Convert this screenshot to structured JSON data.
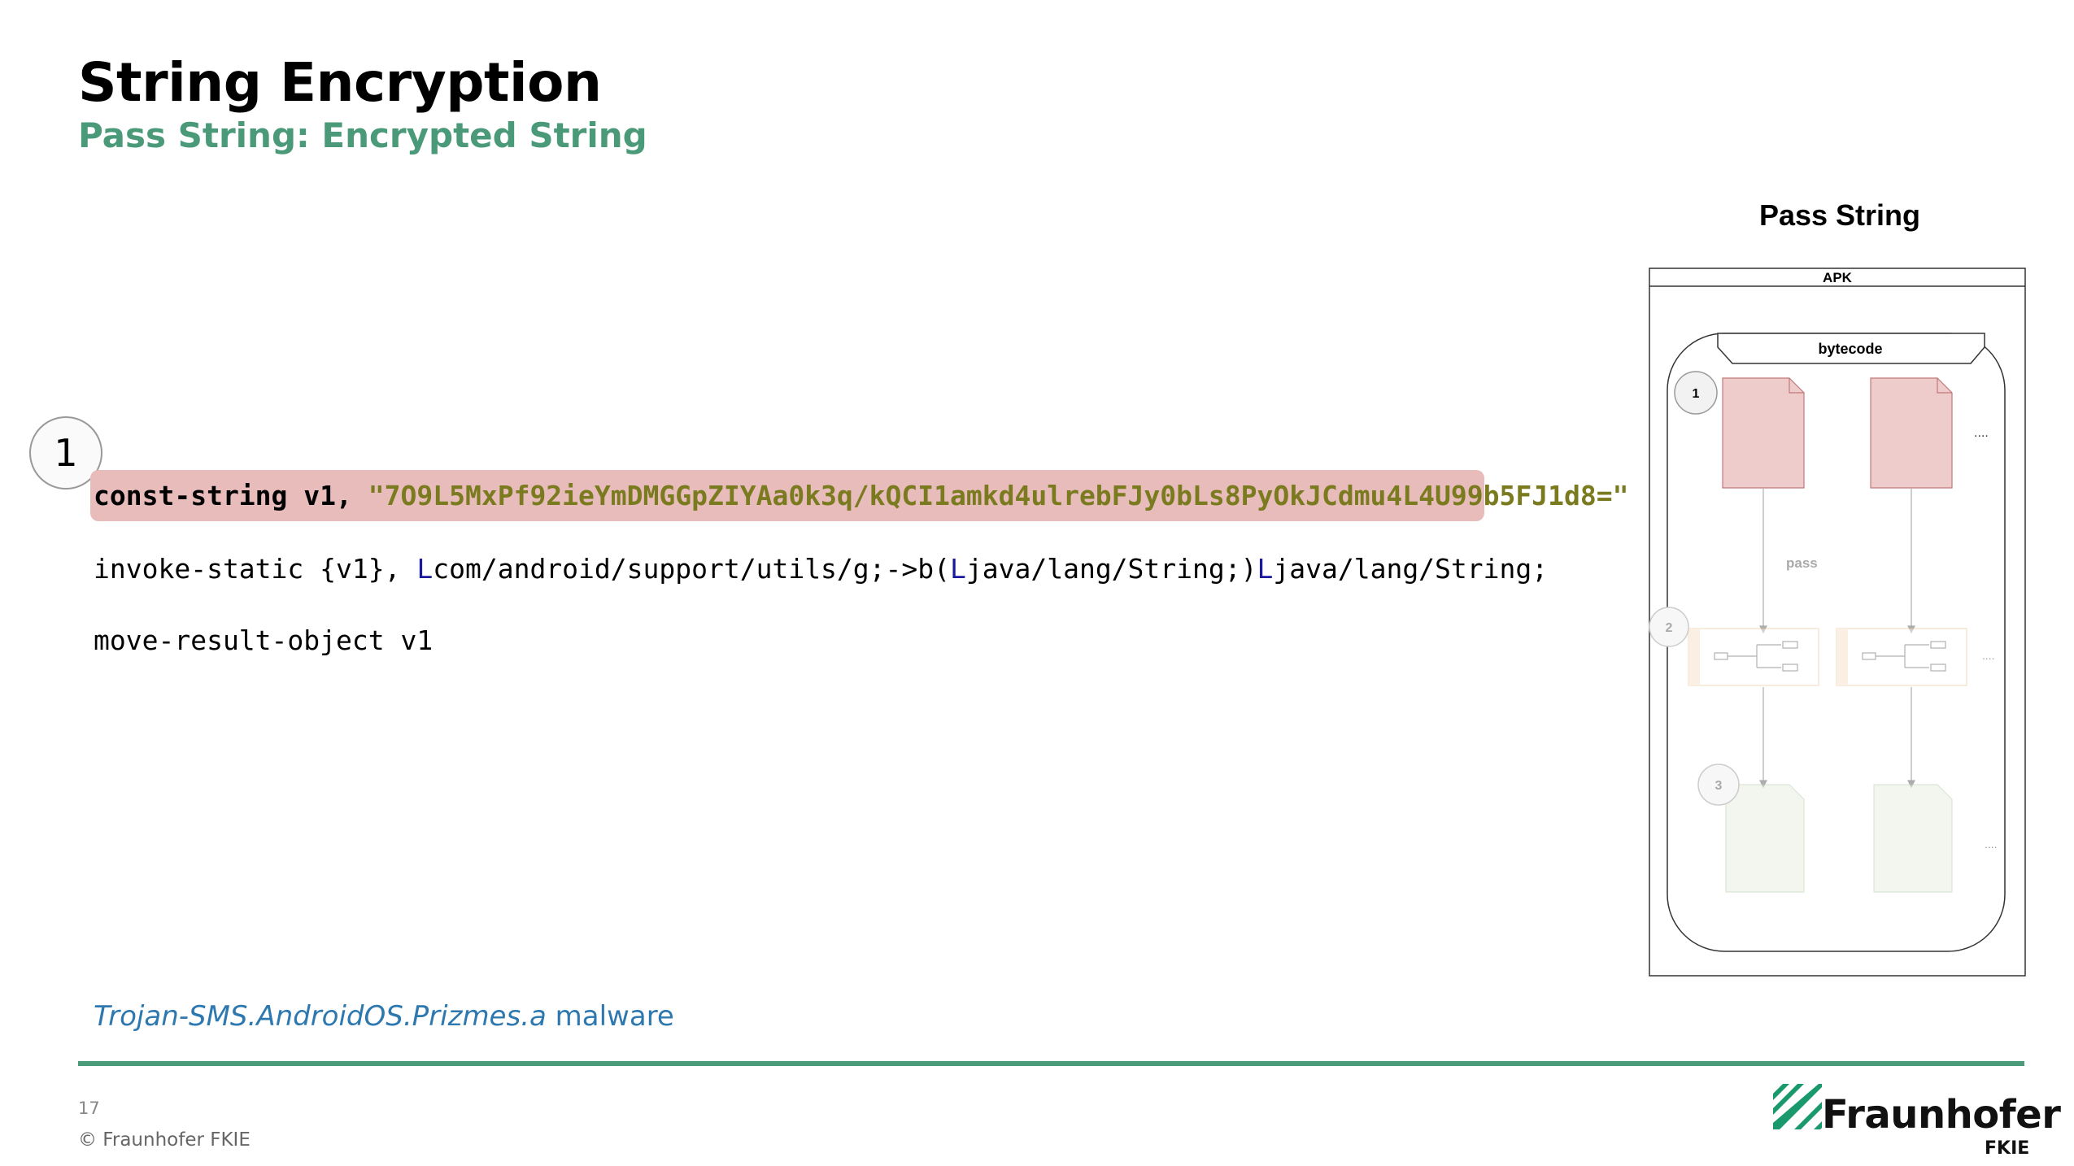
{
  "header": {
    "title": "String Encryption",
    "subtitle": "Pass String: Encrypted String"
  },
  "step_marker": "1",
  "code": {
    "line1_prefix": "const-string v1, ",
    "line1_string": "\"7O9L5MxPf92ieYmDMGGpZIYAa0k3q/kQCI1amkd4ulrebFJy0bLs8PyOkJCdmu4L4U99b5FJ1d8=\"",
    "line2_a": "invoke-static {v1}, ",
    "line2_L1": "L",
    "line2_b": "com/android/support/utils/g;->b(",
    "line2_L2": "L",
    "line2_c": "java/lang/String;)",
    "line2_L3": "L",
    "line2_d": "java/lang/String;",
    "line3": "move-result-object v1"
  },
  "malware_note": {
    "name": "Trojan-SMS.AndroidOS.Prizmes.a",
    "suffix": " malware"
  },
  "footer": {
    "page_number": "17",
    "copyright": "© Fraunhofer FKIE",
    "logo_name": "Fraunhofer",
    "logo_sub": "FKIE"
  },
  "diagram": {
    "title": "Pass String",
    "apk_label": "APK",
    "bytecode_label": "bytecode",
    "step1": "1",
    "step2": "2",
    "step3": "3",
    "pass_label": "pass",
    "ellipsis": "....",
    "ellipsis_faded": "...."
  },
  "colors": {
    "accent_green": "#4a9a79",
    "highlight_pink": "#e9bcbc",
    "link_blue": "#2e78b0"
  }
}
